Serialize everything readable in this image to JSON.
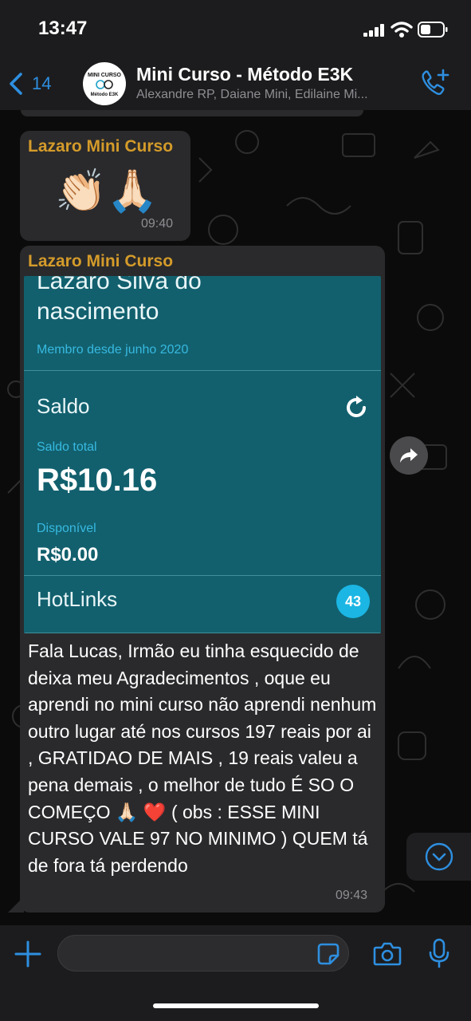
{
  "status_bar": {
    "time": "13:47"
  },
  "header": {
    "back_count": "14",
    "avatar_text_top": "MINI CURSO",
    "avatar_text_bottom": "Método E3K",
    "title": "Mini Curso - Método E3K",
    "subtitle": "Alexandre RP, Daiane Mini, Edilaine Mi..."
  },
  "messages": [
    {
      "sender": "Lazaro Mini Curso",
      "emoji": "👏🏻🙏🏻",
      "time": "09:40"
    },
    {
      "sender": "Lazaro Mini Curso",
      "card": {
        "name_top": "Lazaro Silva do",
        "name": "nascimento",
        "member_since": "Membro desde junho 2020",
        "saldo_label": "Saldo",
        "saldo_total_label": "Saldo total",
        "saldo_total": "R$10.16",
        "disponivel_label": "Disponível",
        "disponivel": "R$0.00",
        "hotlinks_label": "HotLinks",
        "hotlinks_count": "43"
      },
      "text": "Fala Lucas,  Irmão eu tinha esquecido de deixa meu Agradecimentos , oque eu aprendi no mini curso não aprendi nenhum outro lugar até nos cursos 197 reais por ai , GRATIDAO DE MAIS , 19 reais valeu a pena demais , o melhor de tudo É SO O COMEÇO 🙏🏻 ❤️  ( obs : ESSE MINI CURSO VALE 97 NO MINIMO ) QUEM tá de fora tá perdendo",
      "time": "09:43"
    }
  ],
  "colors": {
    "accent": "#2e8fe0",
    "sender": "#d49b2a",
    "bubble": "#2a2a2c",
    "card": "#12606e",
    "card_label": "#37b9e0",
    "badge": "#1bb6e4"
  },
  "icons": [
    "back-chevron-icon",
    "add-call-icon",
    "refresh-icon",
    "forward-icon",
    "scroll-down-icon",
    "plus-icon",
    "sticker-icon",
    "camera-icon",
    "microphone-icon"
  ]
}
